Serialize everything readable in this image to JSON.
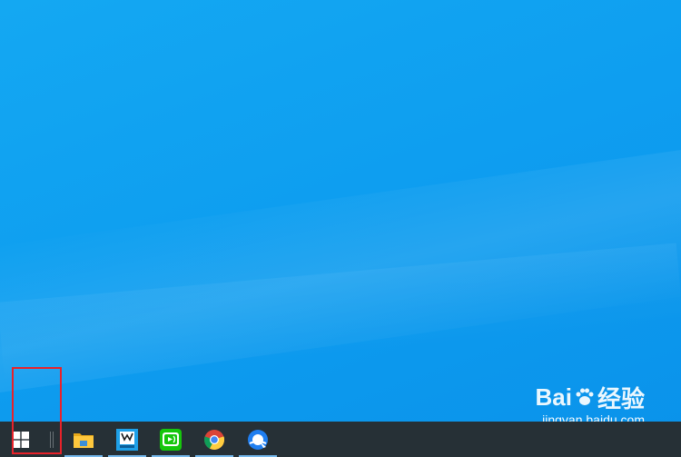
{
  "taskbar": {
    "start_button": {
      "icon": "windows-logo-icon"
    },
    "apps": [
      {
        "name": "file-explorer",
        "icon": "folder-icon",
        "running": true
      },
      {
        "name": "app-blue-tile",
        "icon": "blue-tile-icon",
        "running": true
      },
      {
        "name": "app-green",
        "icon": "green-app-icon",
        "running": true
      },
      {
        "name": "chrome",
        "icon": "chrome-icon",
        "running": true
      },
      {
        "name": "app-q",
        "icon": "q-browser-icon",
        "running": true
      }
    ]
  },
  "watermark": {
    "logo_text_1": "Bai",
    "logo_text_2": "经验",
    "url": "jingyan.baidu.com"
  },
  "colors": {
    "wallpaper": "#0e9ef0",
    "taskbar": "#263036",
    "running_indicator": "#76b9ed",
    "highlight": "#e8222a"
  }
}
